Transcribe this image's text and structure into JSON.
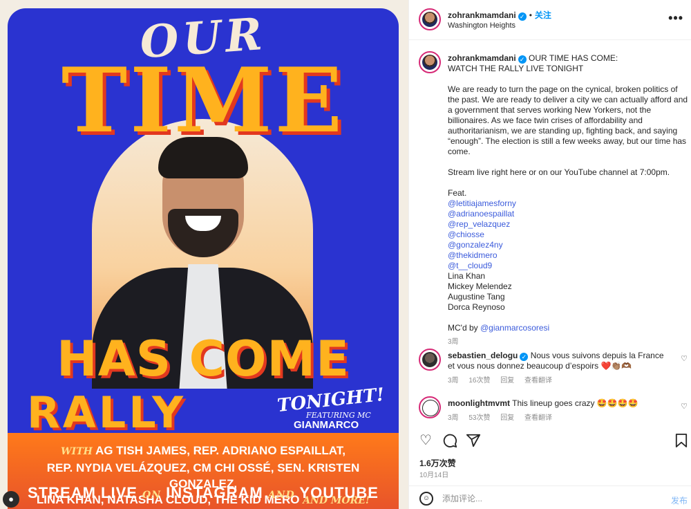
{
  "poster": {
    "our": "OUR",
    "time": "TIME",
    "has_come": "HAS COME",
    "rally": "RALLY",
    "tonight": "TONIGHT!",
    "featuring": "FEATURING MC",
    "mc": "GIANMARCO SORESI",
    "with": "WITH",
    "lineup_1": "AG TISH JAMES, REP. ADRIANO ESPAILLAT,",
    "lineup_2": "REP. NYDIA VELÁZQUEZ, CM CHI OSSÉ, SEN. KRISTEN GONZALEZ,",
    "lineup_3": "LINA KHAN, NATASHA CLOUD, THE KID MERO",
    "and_more": "AND MORE!",
    "stream_1": "STREAM LIVE",
    "stream_on": "ON",
    "stream_2": "INSTAGRAM",
    "stream_and": "AND",
    "stream_3": "YOUTUBE"
  },
  "header": {
    "username": "zohrankmamdani",
    "follow": "关注",
    "location": "Washington Heights",
    "more": "•••"
  },
  "caption": {
    "username": "zohrankmamdani",
    "title_1": "OUR TIME HAS COME:",
    "title_2": "WATCH THE RALLY LIVE TONIGHT",
    "para_1": "We are ready to turn the page on the cynical, broken politics of the past. We are ready to deliver a city we can actually afford and a government that serves working New Yorkers, not the billionaires. As we face twin crises of affordability and authoritarianism, we are standing up, fighting back, and saying “enough”. The election is still a few weeks away, but our time has come.",
    "para_2": "Stream live right here or on our YouTube channel at 7:00pm.",
    "feat": "Feat.",
    "mentions": [
      "@letitiajamesforny",
      "@adrianoespaillat",
      "@rep_velazquez",
      "@chiosse",
      "@gonzalez4ny",
      "@thekidmero",
      "@t__cloud9"
    ],
    "names": [
      "Lina Khan",
      "Mickey Melendez",
      "Augustine Tang",
      "Dorca Reynoso"
    ],
    "mcd_by": "MC'd by",
    "mc_mention": "@gianmarcosoresi",
    "time": "3周"
  },
  "comments": [
    {
      "username": "sebastien_delogu",
      "text": "Nous vous suivons depuis la France et vous nous donnez beaucoup d’espoirs ❤️👏🏽🫶🏾",
      "time": "3周",
      "likes": "16次赞",
      "reply": "回复",
      "translate": "查看翻译"
    },
    {
      "username": "moonlightmvmt",
      "text": "This lineup goes crazy 🤩🤩🤩🤩",
      "time": "3周",
      "likes": "53次赞",
      "reply": "回复",
      "translate": "查看翻译"
    }
  ],
  "stats": {
    "likes": "1.6万次赞",
    "date": "10月14日"
  },
  "composer": {
    "placeholder": "添加评论...",
    "post": "发布"
  },
  "icons": [
    "heart-icon",
    "comment-icon",
    "share-icon",
    "bookmark-icon",
    "emoji-icon",
    "verified-icon",
    "more-icon",
    "user-tag-icon"
  ],
  "colors": {
    "poster_blue": "#2a33d0",
    "poster_yellow": "#ffb21e",
    "poster_red": "#e2381f",
    "link_blue": "#3b5bdb",
    "follow_blue": "#0095f6"
  }
}
